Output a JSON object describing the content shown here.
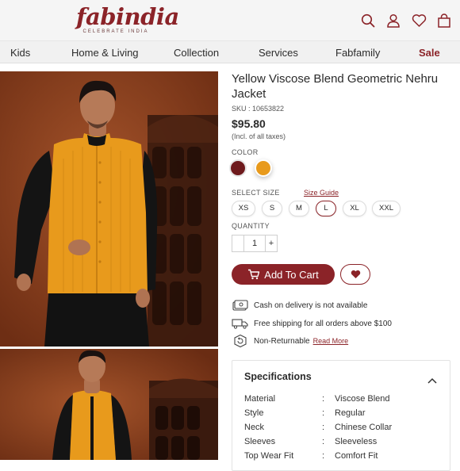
{
  "brand": {
    "name": "fabindia",
    "tagline": "CELEBRATE INDIA"
  },
  "header_icons": [
    "search-icon",
    "user-icon",
    "heart-icon",
    "bag-icon"
  ],
  "nav": {
    "items": [
      "Kids",
      "Home & Living",
      "Collection",
      "Services",
      "Fabfamily",
      "Sale"
    ]
  },
  "product": {
    "title": "Yellow Viscose Blend Geometric Nehru Jacket",
    "sku": "SKU : 10653822",
    "price": "$95.80",
    "tax_note": "(Incl. of all taxes)",
    "color_label": "COLOR",
    "colors": [
      "#6e1a1d",
      "#e89a1c"
    ],
    "selected_color_index": 1,
    "size_label": "SELECT SIZE",
    "size_guide": "Size Guide",
    "sizes": [
      "XS",
      "S",
      "M",
      "L",
      "XL",
      "XXL"
    ],
    "selected_size": "L",
    "quantity_label": "QUANTITY",
    "quantity": "1",
    "qty_minus": "",
    "qty_plus": "+",
    "add_to_cart": "Add To Cart"
  },
  "features": [
    {
      "icon": "cash-icon",
      "text": "Cash on delivery is not available",
      "link": ""
    },
    {
      "icon": "truck-icon",
      "text": "Free shipping for all orders above $100",
      "link": ""
    },
    {
      "icon": "return-icon",
      "text": "Non-Returnable",
      "link": "Read More"
    }
  ],
  "specifications": {
    "title": "Specifications",
    "rows": [
      {
        "key": "Material",
        "value": "Viscose Blend"
      },
      {
        "key": "Style",
        "value": "Regular"
      },
      {
        "key": "Neck",
        "value": "Chinese Collar"
      },
      {
        "key": "Sleeves",
        "value": "Sleeveless"
      },
      {
        "key": "Top Wear Fit",
        "value": "Comfort Fit"
      }
    ],
    "separator": ":"
  },
  "colors": {
    "brand": "#8b2328",
    "background_photo": "#8a3f1c",
    "jacket": "#e89a1c"
  }
}
